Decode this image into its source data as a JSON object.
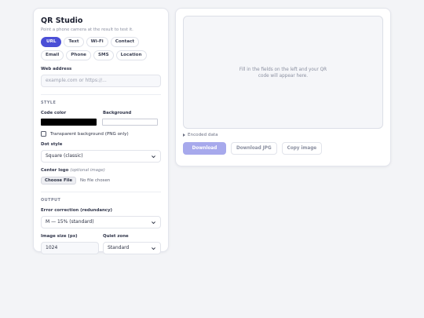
{
  "app": {
    "title": "QR Studio",
    "subtitle": "Point a phone camera at the result to test it."
  },
  "tabs": [
    {
      "label": "URL",
      "active": true
    },
    {
      "label": "Text",
      "active": false
    },
    {
      "label": "Wi-Fi",
      "active": false
    },
    {
      "label": "Contact",
      "active": false
    },
    {
      "label": "Email",
      "active": false
    },
    {
      "label": "Phone",
      "active": false
    },
    {
      "label": "SMS",
      "active": false
    },
    {
      "label": "Location",
      "active": false
    }
  ],
  "web": {
    "label": "Web address",
    "placeholder": "example.com or https://..."
  },
  "style": {
    "section": "STYLE",
    "code_color_label": "Code color",
    "code_color": "#000000",
    "background_label": "Background",
    "background_color": "#ffffff",
    "transparent_label": "Transparent background (PNG only)",
    "dot_style_label": "Dot style",
    "dot_style_value": "Square (classic)",
    "logo_label": "Center logo",
    "logo_hint": "(optional image)",
    "choose_file": "Choose File",
    "no_file": "No file chosen"
  },
  "output": {
    "section": "OUTPUT",
    "ec_label": "Error correction (redundancy)",
    "ec_value": "M — 15% (standard)",
    "size_label": "Image size (px)",
    "size_value": "1024",
    "quiet_label": "Quiet zone",
    "quiet_value": "Standard"
  },
  "preview": {
    "placeholder": "Fill in the fields on the left and your QR code will appear here.",
    "encoded_label": "Encoded data"
  },
  "actions": {
    "download_png": "Download PNG",
    "download_jpg": "Download JPG",
    "copy_image": "Copy image"
  },
  "colors": {
    "accent": "#4b4fd6",
    "accent_disabled": "#a7a9ec"
  }
}
